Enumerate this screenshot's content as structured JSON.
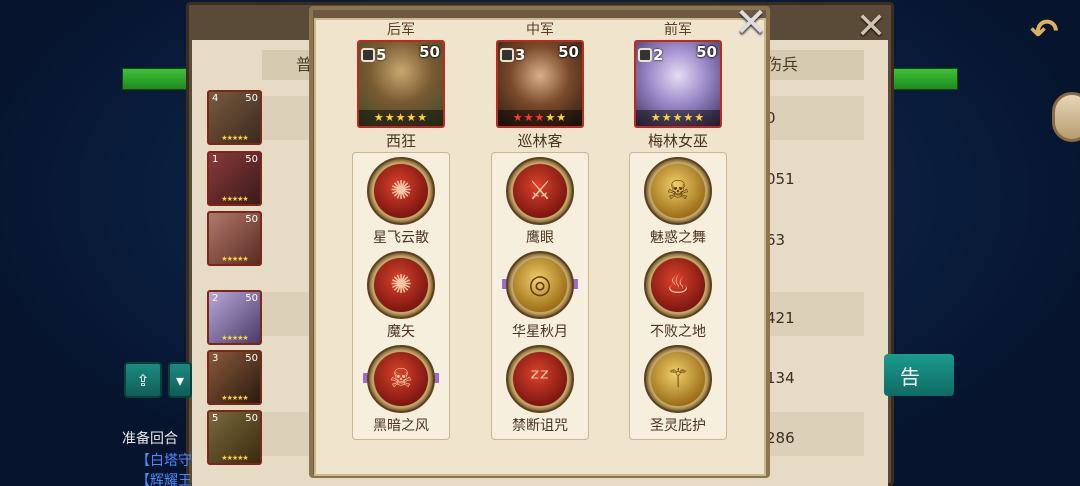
{
  "background": {
    "report_button_label": "告",
    "prep_label": "准备回合",
    "log_lines": [
      "【白塔守",
      "【辉耀王"
    ],
    "column_headers": {
      "left": "普",
      "right": "伤兵"
    },
    "damage_values": [
      "0",
      "051",
      "63",
      "421",
      "134",
      "286"
    ],
    "mini_heroes": [
      {
        "lv": "4",
        "num": "50"
      },
      {
        "lv": "1",
        "num": "50"
      },
      {
        "lv": "",
        "num": "50"
      },
      {
        "lv": "2",
        "num": "50"
      },
      {
        "lv": "3",
        "num": "50"
      },
      {
        "lv": "5",
        "num": "50"
      }
    ]
  },
  "lineup": {
    "columns": [
      {
        "row_label": "后军",
        "hero": {
          "name": "西狂",
          "rank": "5",
          "level": "50",
          "stars": "★★★★★",
          "star_color": "gold"
        },
        "skills": [
          {
            "name": "星飞云散",
            "icon": "fire-claw-icon",
            "tone": "red"
          },
          {
            "name": "魔矢",
            "icon": "fire-claw-icon",
            "tone": "red"
          },
          {
            "name": "黑暗之风",
            "icon": "skull-icon",
            "tone": "red"
          }
        ]
      },
      {
        "row_label": "中军",
        "hero": {
          "name": "巡林客",
          "rank": "3",
          "level": "50",
          "stars": "★★★★★",
          "star_color": "red-gold"
        },
        "skills": [
          {
            "name": "鹰眼",
            "icon": "crossed-blades-icon",
            "tone": "red"
          },
          {
            "name": "华星秋月",
            "icon": "target-icon",
            "tone": "gold"
          },
          {
            "name": "禁断诅咒",
            "icon": "sleep-icon",
            "tone": "red"
          }
        ]
      },
      {
        "row_label": "前军",
        "hero": {
          "name": "梅林女巫",
          "rank": "2",
          "level": "50",
          "stars": "★★★★★",
          "star_color": "gold"
        },
        "skills": [
          {
            "name": "魅惑之舞",
            "icon": "skull-icon",
            "tone": "gold"
          },
          {
            "name": "不败之地",
            "icon": "flame-icon",
            "tone": "red"
          },
          {
            "name": "圣灵庇护",
            "icon": "axe-icon",
            "tone": "gold"
          }
        ]
      }
    ]
  }
}
